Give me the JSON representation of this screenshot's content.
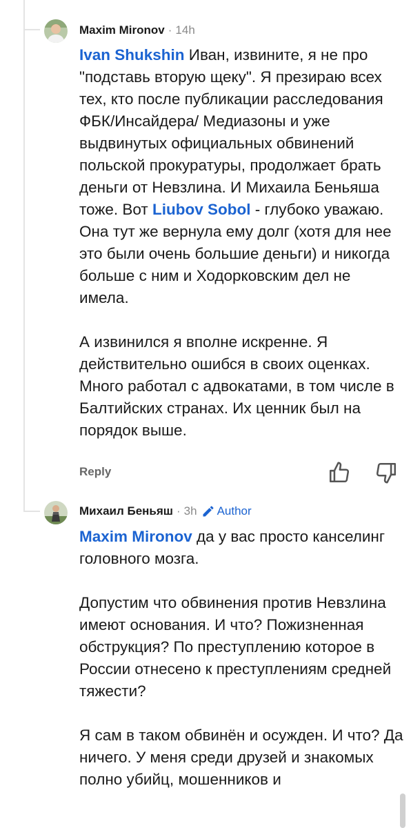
{
  "comments": [
    {
      "author": "Maxim Mironov",
      "separator": "·",
      "time": "14h",
      "paragraphs": [
        {
          "mention": "Ivan  Shukshin",
          "text": " Иван, извините, я не про \"подставь вторую щеку\". Я презираю всех тех, кто после публикации расследования ФБК/Инсайдера/ Медиазоны и уже выдвинутых официальных обвинений польской прокуратуры, продолжает брать деньги от Невзлина. И Михаила Беньяша тоже. Вот ",
          "mention2": "Liubov  Sobol",
          "text2": " - глубоко уважаю. Она тут же вернула ему долг (хотя для нее это были очень большие деньги) и никогда больше с ним и Ходорковским дел не имела."
        },
        {
          "text": "А извинился я вполне искренне. Я действительно ошибся в своих оценках. Много работал с адвокатами, в том числе в Балтийских странах. Их ценник был на порядок выше."
        }
      ],
      "actions": {
        "reply_label": "Reply"
      }
    },
    {
      "author": "Михаил Беньяш",
      "separator": "·",
      "time": "3h",
      "badge": "Author",
      "paragraphs": [
        {
          "mention": "Maxim Mironov",
          "text": " да у вас просто канселинг головного мозга."
        },
        {
          "text": "Допустим что обвинения против Невзлина имеют основания. И что? Пожизненная обструкция? По преступлению которое в России отнесено к преступлениям средней тяжести?"
        },
        {
          "text": "Я сам в таком обвинён и осужден. И что? Да ничего. У меня среди друзей и знакомых полно убийц, мошенников и"
        }
      ]
    }
  ],
  "icons": {
    "like": "thumbs-up-icon",
    "dislike": "thumbs-down-icon",
    "author_badge": "pencil-icon"
  },
  "colors": {
    "mention": "#1b63d1",
    "meta": "#8a8a8a",
    "thread_line": "#e3e3e3"
  }
}
